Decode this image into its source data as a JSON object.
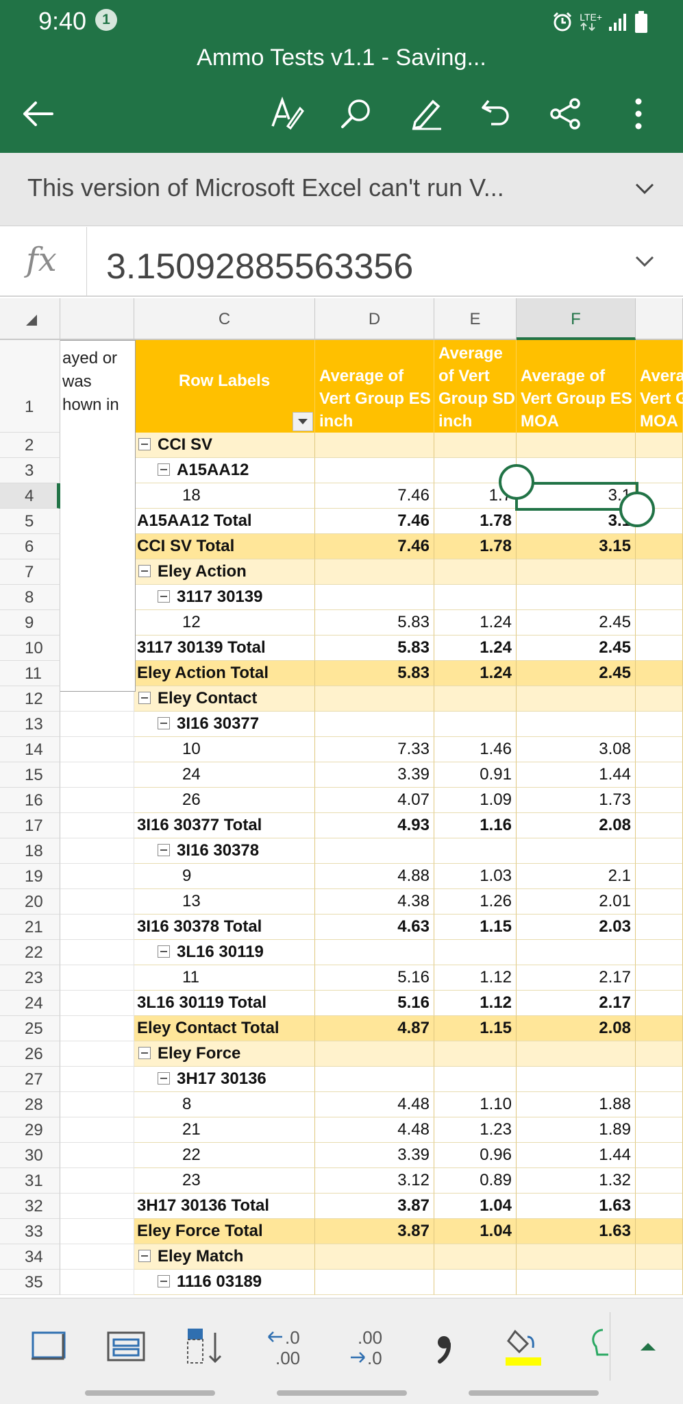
{
  "status_bar": {
    "time": "9:40",
    "notification_count": "1",
    "network": "LTE+"
  },
  "doc_title": "Ammo Tests v1.1 - Saving...",
  "toolbar": {
    "icons": [
      "back-arrow-icon",
      "text-format-icon",
      "search-icon",
      "pen-icon",
      "undo-icon",
      "share-icon",
      "more-icon"
    ]
  },
  "notice": {
    "text": "This version of Microsoft Excel can't run V..."
  },
  "formula_bar": {
    "fx_label": "fx",
    "value": "3.15092885563356"
  },
  "columns": [
    {
      "label": ""
    },
    {
      "label": "C"
    },
    {
      "label": "D"
    },
    {
      "label": "E"
    },
    {
      "label": "F",
      "selected": true
    },
    {
      "label": ""
    }
  ],
  "comment": {
    "lines": [
      "ayed or",
      "was",
      "hown in"
    ]
  },
  "pivot_headers": {
    "row_labels": "Row Labels",
    "d": [
      "Average of",
      "Vert Group ES",
      "inch"
    ],
    "e": [
      "Average",
      "of Vert",
      "Group SD",
      "inch"
    ],
    "f": [
      "Average of",
      "Vert Group ES",
      "MOA"
    ],
    "g": [
      "Avera",
      "Vert G",
      "MOA"
    ]
  },
  "header_row_number": "1",
  "rows": [
    {
      "num": "2",
      "label": "CCI SV",
      "level": 0,
      "type": "group",
      "d": "",
      "e": "",
      "f": ""
    },
    {
      "num": "3",
      "label": "A15AA12",
      "level": 1,
      "type": "sub",
      "d": "",
      "e": "",
      "f": ""
    },
    {
      "num": "4",
      "label": "18",
      "level": 2,
      "type": "item",
      "d": "7.46",
      "e": "1.7",
      "f": "3.1",
      "active": true
    },
    {
      "num": "5",
      "label": "A15AA12 Total",
      "level": 0,
      "type": "subtotal",
      "d": "7.46",
      "e": "1.78",
      "f": "3.1"
    },
    {
      "num": "6",
      "label": "CCI SV Total",
      "level": 0,
      "type": "total",
      "d": "7.46",
      "e": "1.78",
      "f": "3.15"
    },
    {
      "num": "7",
      "label": "Eley Action",
      "level": 0,
      "type": "group",
      "d": "",
      "e": "",
      "f": ""
    },
    {
      "num": "8",
      "label": "3117 30139",
      "level": 1,
      "type": "sub",
      "d": "",
      "e": "",
      "f": ""
    },
    {
      "num": "9",
      "label": "12",
      "level": 2,
      "type": "item",
      "d": "5.83",
      "e": "1.24",
      "f": "2.45"
    },
    {
      "num": "10",
      "label": "3117 30139 Total",
      "level": 0,
      "type": "subtotal",
      "d": "5.83",
      "e": "1.24",
      "f": "2.45"
    },
    {
      "num": "11",
      "label": "Eley Action Total",
      "level": 0,
      "type": "total",
      "d": "5.83",
      "e": "1.24",
      "f": "2.45"
    },
    {
      "num": "12",
      "label": "Eley Contact",
      "level": 0,
      "type": "group",
      "d": "",
      "e": "",
      "f": ""
    },
    {
      "num": "13",
      "label": "3I16 30377",
      "level": 1,
      "type": "sub",
      "d": "",
      "e": "",
      "f": ""
    },
    {
      "num": "14",
      "label": "10",
      "level": 2,
      "type": "item",
      "d": "7.33",
      "e": "1.46",
      "f": "3.08"
    },
    {
      "num": "15",
      "label": "24",
      "level": 2,
      "type": "item",
      "d": "3.39",
      "e": "0.91",
      "f": "1.44"
    },
    {
      "num": "16",
      "label": "26",
      "level": 2,
      "type": "item",
      "d": "4.07",
      "e": "1.09",
      "f": "1.73"
    },
    {
      "num": "17",
      "label": "3I16 30377 Total",
      "level": 0,
      "type": "subtotal",
      "d": "4.93",
      "e": "1.16",
      "f": "2.08"
    },
    {
      "num": "18",
      "label": "3I16 30378",
      "level": 1,
      "type": "sub",
      "d": "",
      "e": "",
      "f": ""
    },
    {
      "num": "19",
      "label": "9",
      "level": 2,
      "type": "item",
      "d": "4.88",
      "e": "1.03",
      "f": "2.1"
    },
    {
      "num": "20",
      "label": "13",
      "level": 2,
      "type": "item",
      "d": "4.38",
      "e": "1.26",
      "f": "2.01"
    },
    {
      "num": "21",
      "label": "3I16 30378 Total",
      "level": 0,
      "type": "subtotal",
      "d": "4.63",
      "e": "1.15",
      "f": "2.03"
    },
    {
      "num": "22",
      "label": "3L16 30119",
      "level": 1,
      "type": "sub",
      "d": "",
      "e": "",
      "f": ""
    },
    {
      "num": "23",
      "label": "11",
      "level": 2,
      "type": "item",
      "d": "5.16",
      "e": "1.12",
      "f": "2.17"
    },
    {
      "num": "24",
      "label": "3L16 30119 Total",
      "level": 0,
      "type": "subtotal",
      "d": "5.16",
      "e": "1.12",
      "f": "2.17"
    },
    {
      "num": "25",
      "label": "Eley Contact Total",
      "level": 0,
      "type": "total",
      "d": "4.87",
      "e": "1.15",
      "f": "2.08"
    },
    {
      "num": "26",
      "label": "Eley Force",
      "level": 0,
      "type": "group",
      "d": "",
      "e": "",
      "f": ""
    },
    {
      "num": "27",
      "label": "3H17 30136",
      "level": 1,
      "type": "sub",
      "d": "",
      "e": "",
      "f": ""
    },
    {
      "num": "28",
      "label": "8",
      "level": 2,
      "type": "item",
      "d": "4.48",
      "e": "1.10",
      "f": "1.88"
    },
    {
      "num": "29",
      "label": "21",
      "level": 2,
      "type": "item",
      "d": "4.48",
      "e": "1.23",
      "f": "1.89"
    },
    {
      "num": "30",
      "label": "22",
      "level": 2,
      "type": "item",
      "d": "3.39",
      "e": "0.96",
      "f": "1.44"
    },
    {
      "num": "31",
      "label": "23",
      "level": 2,
      "type": "item",
      "d": "3.12",
      "e": "0.89",
      "f": "1.32"
    },
    {
      "num": "32",
      "label": "3H17 30136 Total",
      "level": 0,
      "type": "subtotal",
      "d": "3.87",
      "e": "1.04",
      "f": "1.63"
    },
    {
      "num": "33",
      "label": "Eley Force Total",
      "level": 0,
      "type": "total",
      "d": "3.87",
      "e": "1.04",
      "f": "1.63"
    },
    {
      "num": "34",
      "label": "Eley Match",
      "level": 0,
      "type": "group",
      "d": "",
      "e": "",
      "f": ""
    },
    {
      "num": "35",
      "label": "1116 03189",
      "level": 1,
      "type": "sub",
      "d": "",
      "e": "",
      "f": ""
    }
  ],
  "colors": {
    "excel_green": "#217346",
    "pivot_header": "#ffc000",
    "group_row": "#fff2cc",
    "total_row": "#ffe699",
    "highlight_yellow": "#ffff00"
  },
  "bottom_toolbar": {
    "icons": [
      "freeze-panes-icon",
      "freeze-top-row-icon",
      "sort-icon",
      "decrease-decimal-icon",
      "increase-decimal-icon",
      "comma-style-icon",
      "fill-color-icon",
      "lightbulb-icon",
      "expand-ribbon-icon"
    ],
    "decrease_decimal": [
      ".0",
      ".00"
    ],
    "increase_decimal": [
      ".00",
      ".0"
    ],
    "comma": ","
  }
}
